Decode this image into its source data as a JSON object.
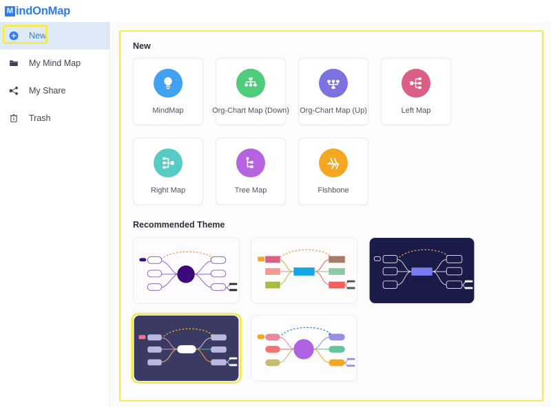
{
  "app": {
    "logo_mark": "M",
    "logo_text": "indOnMap"
  },
  "sidebar": {
    "items": [
      {
        "label": "New",
        "icon": "plus-circle-icon",
        "active": true
      },
      {
        "label": "My Mind Map",
        "icon": "folder-icon",
        "active": false
      },
      {
        "label": "My Share",
        "icon": "share-nodes-icon",
        "active": false
      },
      {
        "label": "Trash",
        "icon": "trash-icon",
        "active": false
      }
    ]
  },
  "main": {
    "new_section_title": "New",
    "theme_section_title": "Recommended Theme",
    "templates": [
      {
        "label": "MindMap",
        "icon": "lightbulb-icon",
        "color": "#41A0F0"
      },
      {
        "label": "Org-Chart Map (Down)",
        "icon": "org-chart-down-icon",
        "color": "#4ECB7B"
      },
      {
        "label": "Org-Chart Map (Up)",
        "icon": "org-chart-up-icon",
        "color": "#7B72E0"
      },
      {
        "label": "Left Map",
        "icon": "left-map-icon",
        "color": "#DB5F84"
      },
      {
        "label": "Right Map",
        "icon": "right-map-icon",
        "color": "#55CBC4"
      },
      {
        "label": "Tree Map",
        "icon": "tree-map-icon",
        "color": "#B563DE"
      },
      {
        "label": "Fishbone",
        "icon": "fishbone-icon",
        "color": "#F5A623"
      }
    ],
    "themes": [
      {
        "name": "theme-light-purple-circle",
        "selected": false,
        "background": "#fdfbfe",
        "center": "#3B0A78",
        "center_shape": "circle",
        "node_fill": "#ffffff",
        "node_stroke": "#8268c4",
        "arrow": "#F29D4B"
      },
      {
        "name": "theme-colorful-rect",
        "selected": false,
        "background": "#fdfcfb",
        "center": "#13A5E8",
        "center_shape": "rect",
        "node_fill": "#ffffff",
        "node_stroke": "#d8d0cc",
        "arrow": "#F29D4B"
      },
      {
        "name": "theme-dark-navy",
        "selected": false,
        "background": "#1B1B4A",
        "center": "#7B7BF0",
        "center_shape": "rect",
        "node_fill": "#1B1B4A",
        "node_stroke": "#d8d8e8",
        "arrow": "#E09A2B"
      },
      {
        "name": "theme-dark-slate",
        "selected": true,
        "background": "#3A3A63",
        "center": "#ffffff",
        "center_shape": "pill",
        "node_fill": "#b9b8e0",
        "node_stroke": "#b9b8e0",
        "arrow": "#D8A43A"
      },
      {
        "name": "theme-light-pastel-circle",
        "selected": false,
        "background": "#fdfdfd",
        "center": "#AE63E4",
        "center_shape": "circle",
        "node_fill": "#ffffff",
        "node_stroke": "#d9d2e6",
        "arrow": "#2E8BE0"
      }
    ]
  },
  "annotations": {
    "highlight_color": "#f3ea54",
    "highlight_targets": [
      "sidebar-item-new",
      "main-content-panel",
      "theme-card-4"
    ]
  }
}
